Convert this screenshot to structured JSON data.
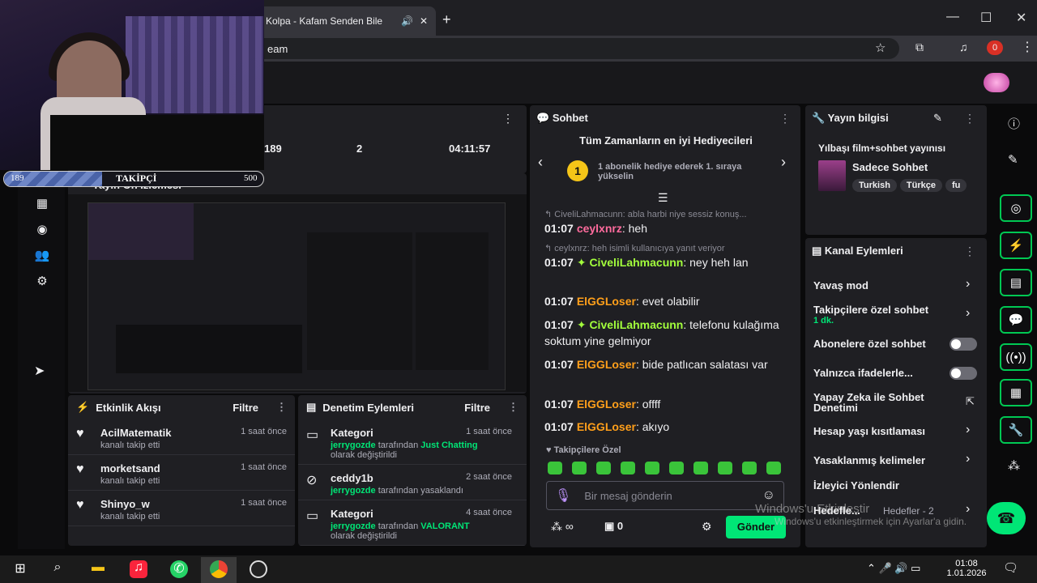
{
  "browser": {
    "tab_title": "Kolpa - Kafam Senden Bile",
    "url_partial": "eam",
    "notification_badge": "0"
  },
  "webcam": {
    "followers_current": "189",
    "followers_label": "TAKİPÇİ",
    "followers_goal": "500",
    "followers_progress": 0.378
  },
  "stats": {
    "followers": "189",
    "subs": "2",
    "uptime": "04:11:57"
  },
  "preview": {
    "title": "Yayın Ön İzlemesi"
  },
  "activity": {
    "title": "Etkinlik Akışı",
    "filter": "Filtre",
    "items": [
      {
        "name": "AcilMatematik",
        "sub": "kanalı takip etti",
        "time": "1 saat önce"
      },
      {
        "name": "morketsand",
        "sub": "kanalı takip etti",
        "time": "1 saat önce"
      },
      {
        "name": "Shinyo_w",
        "sub": "kanalı takip etti",
        "time": "1 saat önce"
      }
    ]
  },
  "audit": {
    "title": "Denetim Eylemleri",
    "filter": "Filtre",
    "items": [
      {
        "name": "Kategori",
        "user": "jerrygozde",
        "mid": " tarafından ",
        "value": "Just Chatting",
        "end": "olarak değiştirildi",
        "time": "1 saat önce"
      },
      {
        "name": "ceddy1b",
        "user": "jerrygozde",
        "mid": " tarafından yasaklandı",
        "value": "",
        "end": "",
        "time": "2 saat önce"
      },
      {
        "name": "Kategori",
        "user": "jerrygozde",
        "mid": " tarafından ",
        "value": "VALORANT",
        "end": "olarak değiştirildi",
        "time": "4 saat önce"
      }
    ]
  },
  "chat": {
    "title": "Sohbet",
    "gifters_title": "Tüm Zamanların en iyi Hediyecileri",
    "gifters_rank": "1",
    "gifters_text": "1 abonelik hediye ederek 1. sıraya yükselin",
    "reply1": "CiveliLahmacunn: abla harbi niye sessiz konuş...",
    "reply2": "ceylxnrz: heh isimli kullanıcıya yanıt veriyor",
    "messages": [
      {
        "time": "01:07",
        "user": "ceylxnrz",
        "text": ": heh"
      },
      {
        "time": "01:07",
        "user": "CiveliLahmacunn",
        "text": ": ney heh lan"
      },
      {
        "time": "01:07",
        "user": "ElGGLoser",
        "text": ": evet olabilir"
      },
      {
        "time": "01:07",
        "user": "CiveliLahmacunn",
        "text": ": telefonu kulağıma soktum yine gelmiyor"
      },
      {
        "time": "01:07",
        "user": "ElGGLoser",
        "text": ": bide patlıcan salatası var"
      },
      {
        "time": "01:07",
        "user": "ElGGLoser",
        "text": ": offff"
      },
      {
        "time": "01:07",
        "user": "ElGGLoser",
        "text": ": akıyo"
      }
    ],
    "followers_only": "Takipçilere Özel",
    "input_placeholder": "Bir mesaj gönderin",
    "points_value": "0",
    "send_label": "Gönder"
  },
  "stream_info": {
    "title": "Yayın bilgisi",
    "stream_title": "Yılbaşı film+sohbet yayınısı",
    "category": "Sadece Sohbet",
    "tags": [
      "Turkish",
      "Türkçe",
      "fu"
    ]
  },
  "channel_actions": {
    "title": "Kanal Eylemleri",
    "items": [
      {
        "label": "Yavaş mod",
        "sub": ""
      },
      {
        "label": "Takipçilere özel sohbet",
        "sub": "1 dk."
      },
      {
        "label": "Abonelere özel sohbet",
        "sub": ""
      },
      {
        "label": "Yalnızca ifadelerle...",
        "sub": ""
      },
      {
        "label": "Yapay Zeka ile Sohbet Denetimi",
        "sub": ""
      },
      {
        "label": "Hesap yaşı kısıtlaması",
        "sub": ""
      },
      {
        "label": "Yasaklanmış kelimeler",
        "sub": ""
      },
      {
        "label": "İzleyici Yönlendir",
        "sub": ""
      },
      {
        "label": "Hedefle...",
        "sub": ""
      }
    ],
    "goals_text": "Hedefler - 2"
  },
  "watermark": {
    "line1": "Windows'u Etkinleştir",
    "line2": "Windows'u etkinleştirmek için Ayarlar'a gidin."
  },
  "taskbar": {
    "time": "01:08",
    "date": "1.01.2026"
  },
  "colors": {
    "accent_green": "#00e676",
    "bg_panel": "#1f1f23",
    "user_pink": "#ff6b9d",
    "user_green": "#a3ff3c",
    "user_orange": "#ff9f1a"
  }
}
